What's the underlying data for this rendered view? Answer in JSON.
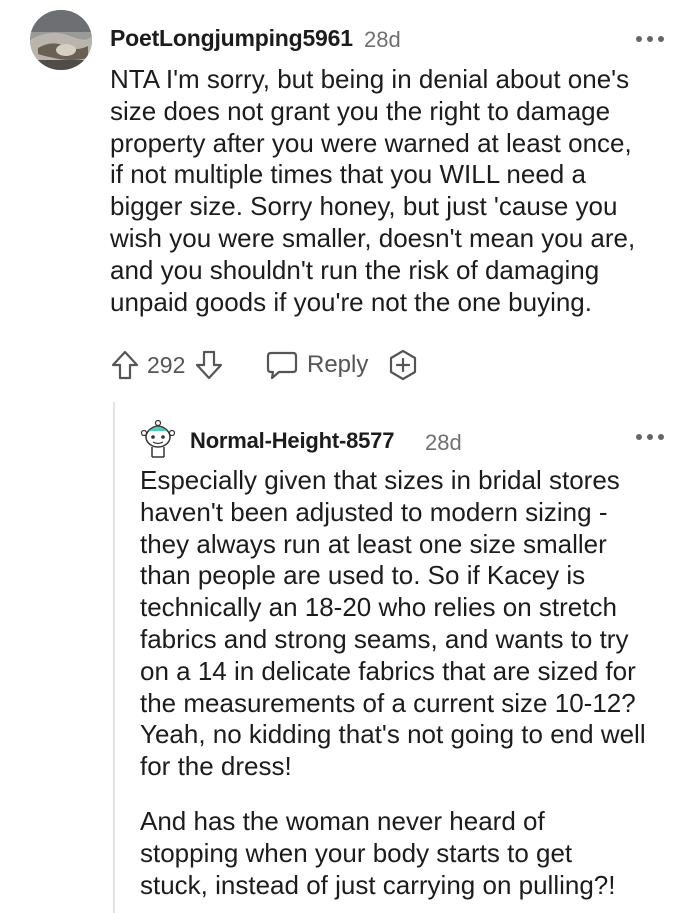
{
  "comment": {
    "username": "PoetLongjumping5961",
    "age": "28d",
    "avatar_icon": "user-avatar-photo",
    "more_icon": "more-options-icon",
    "body_lines": [
      "NTA I'm sorry, but being in denial about one's",
      "size does not grant you the right to damage",
      "property after you were warned at least once,",
      "if not multiple times that you WILL need a",
      "bigger size. Sorry honey, but just 'cause you",
      "wish you were smaller, doesn't mean you are,",
      "and you shouldn't run the risk of damaging",
      "unpaid goods if you're not the one buying."
    ],
    "actions": {
      "upvote_icon": "upvote-arrow-icon",
      "vote_count": "292",
      "downvote_icon": "downvote-arrow-icon",
      "reply_icon": "speech-bubble-icon",
      "reply_label": "Reply",
      "award_icon": "award-plus-icon"
    }
  },
  "reply": {
    "username": "Normal-Height-8577",
    "age": "28d",
    "avatar_icon": "snoo-avatar",
    "more_icon": "more-options-icon",
    "paragraph1_lines": [
      "Especially given that sizes in bridal stores",
      "haven't been adjusted to modern sizing -",
      "they always run at least one size smaller",
      "than people are used to. So if Kacey is",
      "technically an 18-20 who relies on stretch",
      "fabrics and strong seams, and wants to try",
      "on a 14 in delicate fabrics that are sized for",
      "the measurements of a current size 10-12?",
      "Yeah, no kidding that's not going to end well",
      "for the dress!"
    ],
    "paragraph2_lines": [
      "And has the woman never heard of",
      "stopping when your body starts to get",
      "stuck, instead of just carrying on pulling?!"
    ]
  },
  "colors": {
    "text": "#1c1c1c",
    "meta": "#6f6f6f",
    "icon": "#555555",
    "thread_line": "#e4e4e4"
  }
}
